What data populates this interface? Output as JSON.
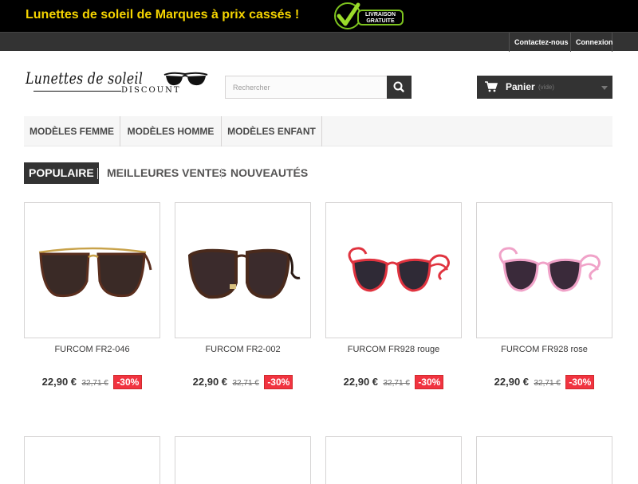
{
  "promo": {
    "title": "Lunettes de soleil de Marques à prix cassés !",
    "badge_line1": "LIVRAISON",
    "badge_line2": "GRATUITE"
  },
  "user_nav": {
    "contact": "Contactez-nous",
    "login": "Connexion"
  },
  "logo": {
    "line1": "Lunettes de soleil",
    "line2": "DISCOUNT"
  },
  "search": {
    "placeholder": "Rechercher"
  },
  "cart": {
    "label": "Panier",
    "status": "(vide)"
  },
  "menu": {
    "items": [
      "MODÈLES FEMME",
      "MODÈLES HOMME",
      "MODÈLES ENFANT"
    ]
  },
  "tabs": [
    "POPULAIRE",
    "MEILLEURES VENTES",
    "NOUVEAUTÉS"
  ],
  "products": [
    {
      "name": "FURCOM FR2-046",
      "price": "22,90 €",
      "old_price": "32,71 €",
      "discount": "-30%",
      "frame_color": "#5a2e1e",
      "lens_color": "#3a2a26",
      "icon": "aviator-sunglasses"
    },
    {
      "name": "FURCOM FR2-002",
      "price": "22,90 €",
      "old_price": "32,71 €",
      "discount": "-30%",
      "frame_color": "#4a2a1c",
      "lens_color": "#3b2b2c",
      "icon": "tortoise-sunglasses"
    },
    {
      "name": "FURCOM FR928 rouge",
      "price": "22,90 €",
      "old_price": "32,71 €",
      "discount": "-30%",
      "frame_color": "#e0333f",
      "lens_color": "#2f2a36",
      "icon": "red-sunglasses"
    },
    {
      "name": "FURCOM FR928 rose",
      "price": "22,90 €",
      "old_price": "32,71 €",
      "discount": "-30%",
      "frame_color": "#f0a2c8",
      "lens_color": "#3a2a3a",
      "icon": "pink-sunglasses"
    }
  ],
  "colors": {
    "promo_text": "#f5d400",
    "dark": "#333333",
    "discount": "#f13340",
    "badge_green": "#7ec41f"
  }
}
